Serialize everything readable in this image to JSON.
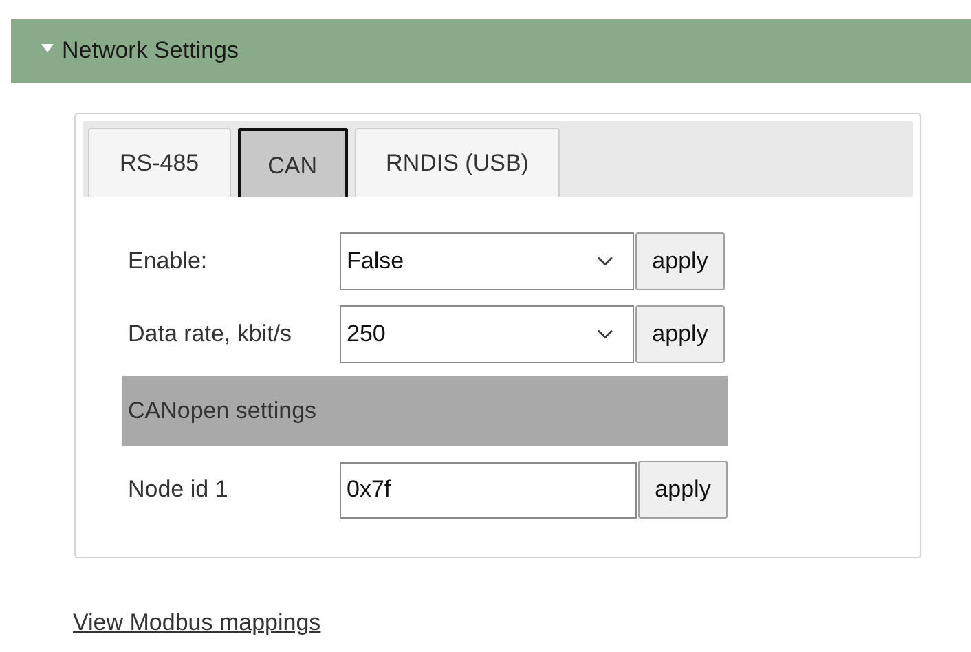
{
  "section": {
    "title": "Network Settings",
    "expanded": true
  },
  "tabs": [
    {
      "label": "RS-485",
      "selected": false
    },
    {
      "label": "CAN",
      "selected": true
    },
    {
      "label": "RNDIS (USB)",
      "selected": false
    }
  ],
  "rows": [
    {
      "kind": "select",
      "label": "Enable:",
      "value": "False",
      "button": "apply"
    },
    {
      "kind": "select",
      "label": "Data rate, kbit/s",
      "value": "250",
      "button": "apply"
    },
    {
      "kind": "section",
      "label": "CANopen settings"
    },
    {
      "kind": "input",
      "label": "Node id 1",
      "value": "0x7f",
      "button": "apply"
    }
  ],
  "link": "View Modbus mappings"
}
